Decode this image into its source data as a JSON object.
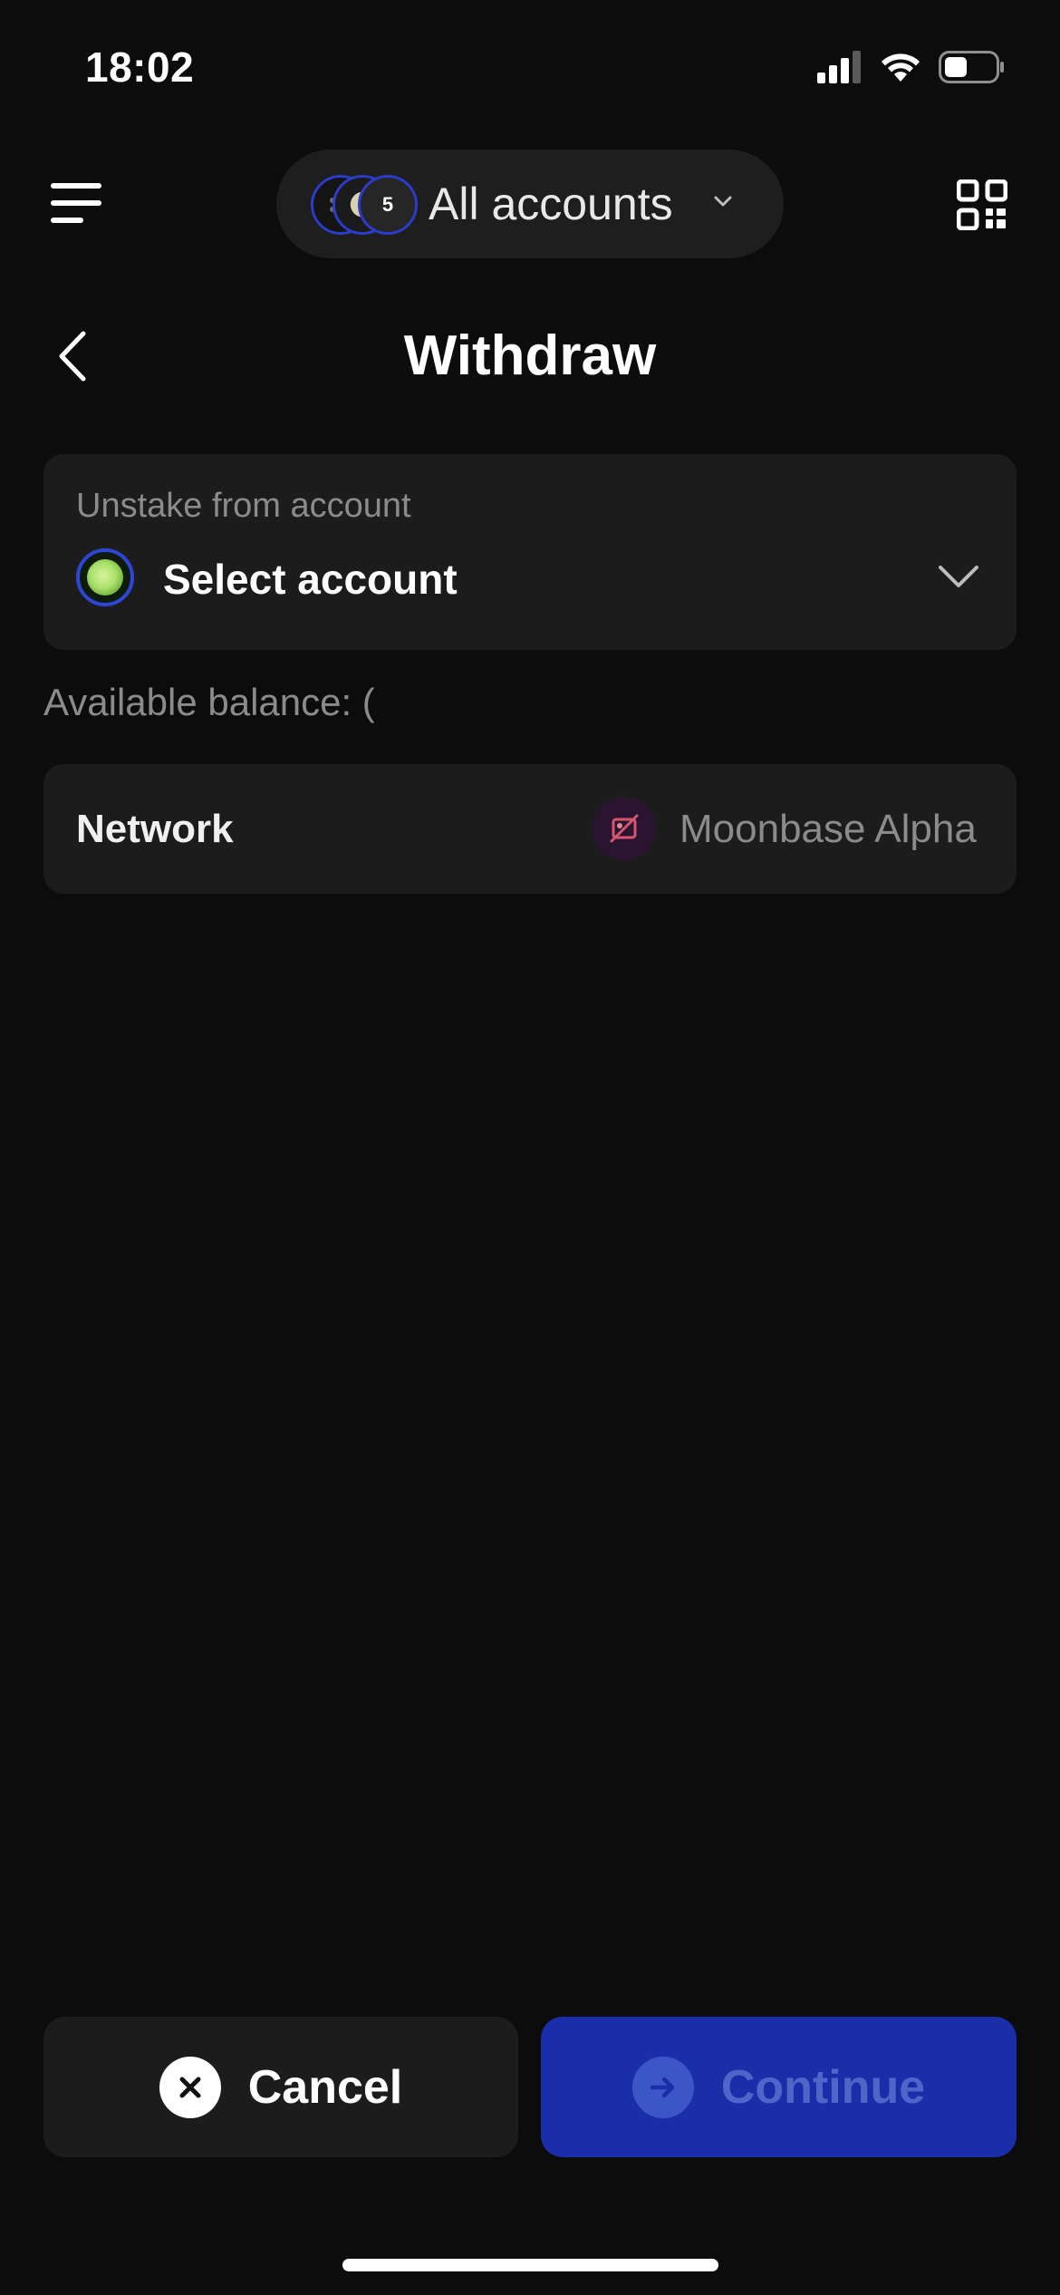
{
  "status_bar": {
    "time": "18:02"
  },
  "header": {
    "account_selector_label": "All accounts",
    "avatar_badge": "5"
  },
  "page": {
    "title": "Withdraw"
  },
  "account_field": {
    "label": "Unstake from account",
    "value": "Select account"
  },
  "balance": {
    "text": "Available balance: ("
  },
  "network_field": {
    "label": "Network",
    "value": "Moonbase Alpha"
  },
  "actions": {
    "cancel_label": "Cancel",
    "continue_label": "Continue"
  },
  "colors": {
    "background": "#0c0c0c",
    "card": "#1c1c1c",
    "accent": "#1b2ea9",
    "muted_text": "#8b8b8b"
  }
}
